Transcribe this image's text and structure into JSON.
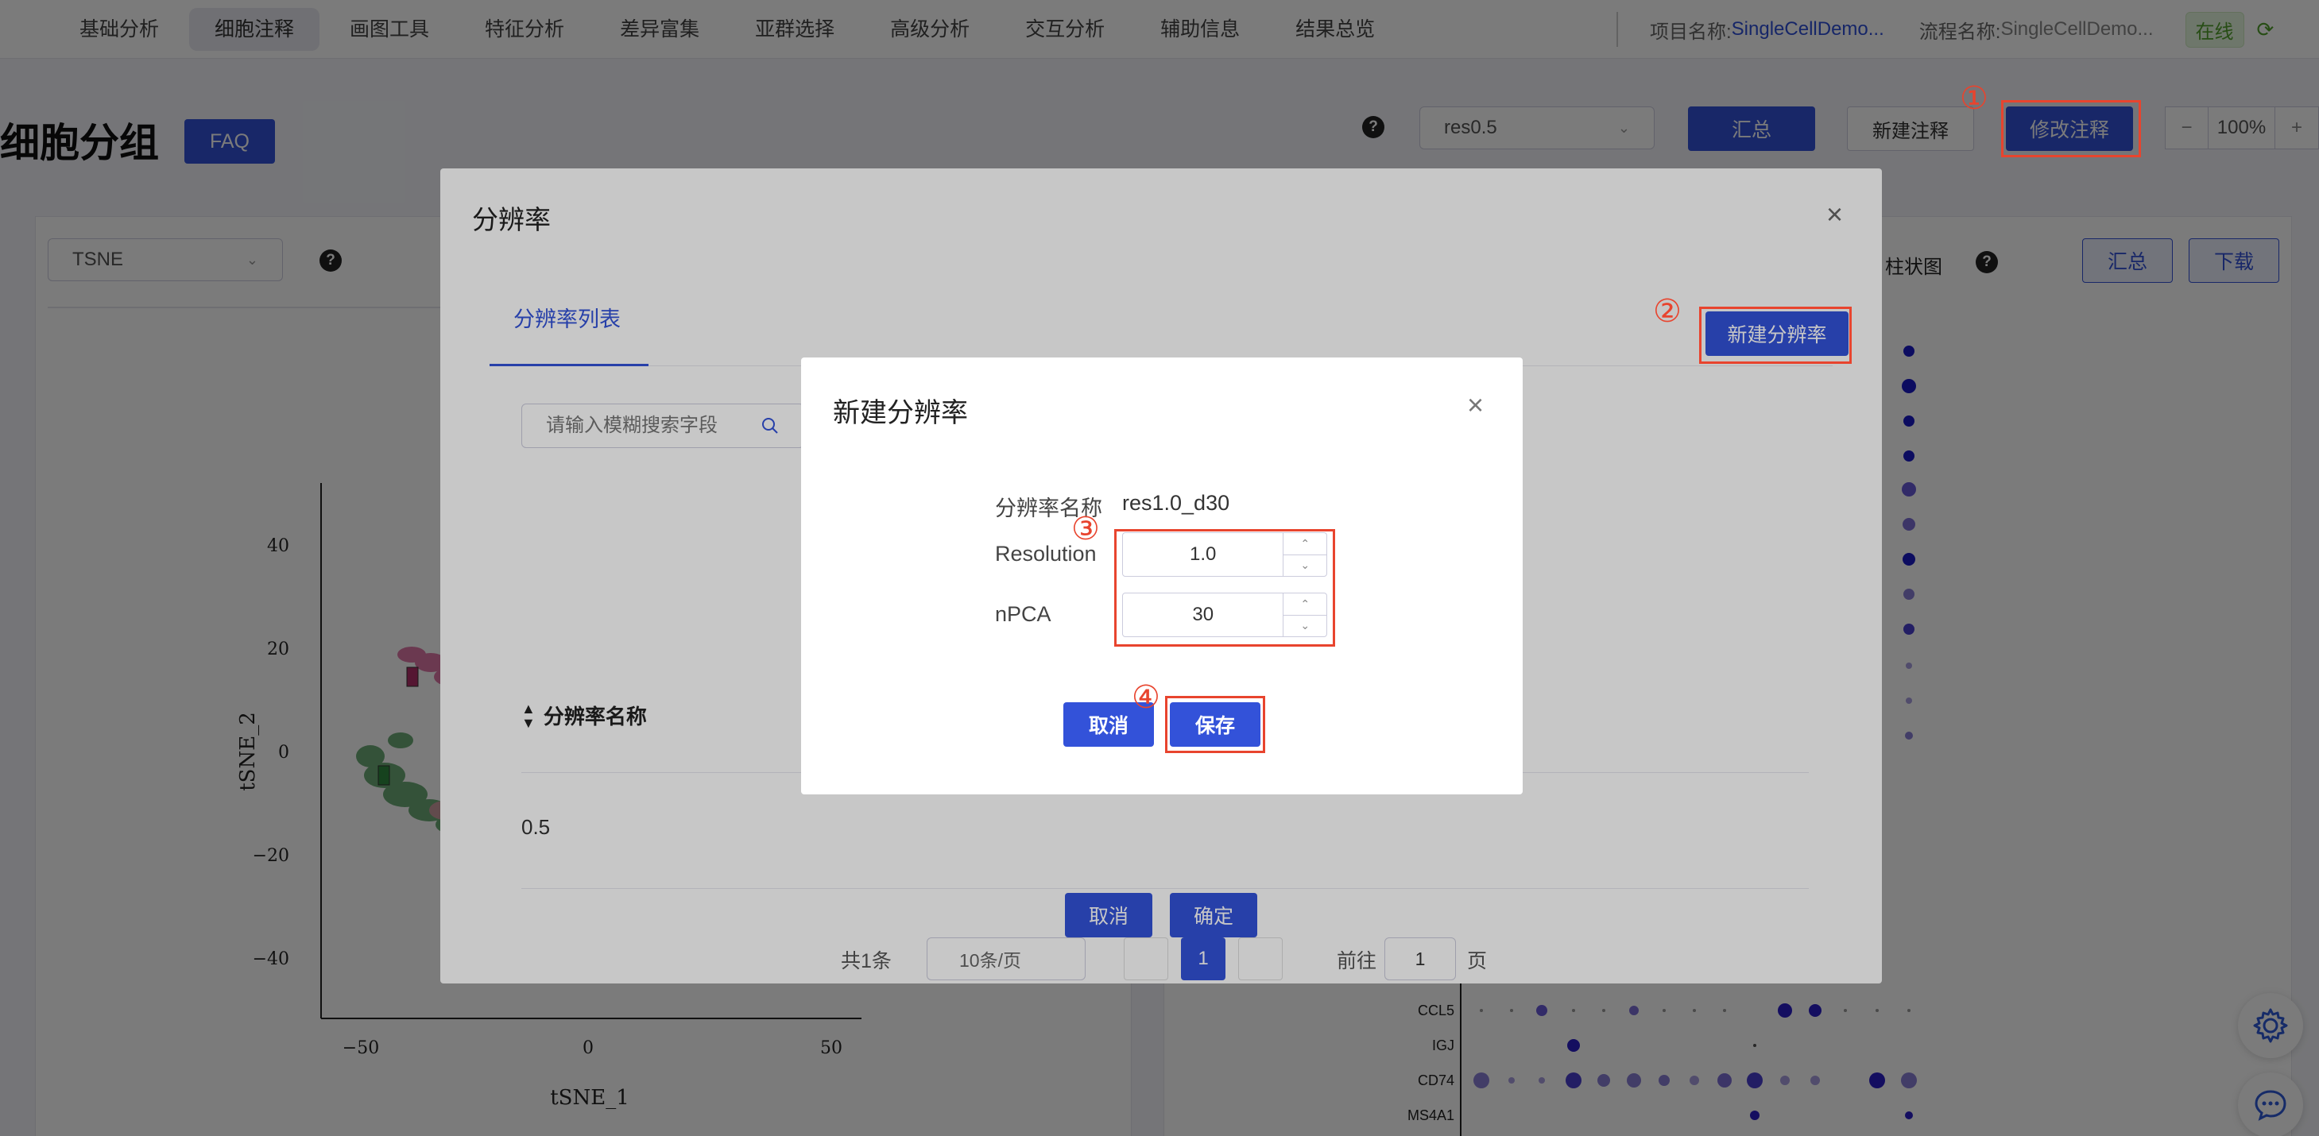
{
  "nav": {
    "tabs": [
      "基础分析",
      "细胞注释",
      "画图工具",
      "特征分析",
      "差异富集",
      "亚群选择",
      "高级分析",
      "交互分析",
      "辅助信息",
      "结果总览"
    ],
    "project_label": "项目名称:",
    "project_value": "SingleCellDemo...",
    "flow_label": "流程名称:",
    "flow_value": "SingleCellDemo...",
    "status": "在线"
  },
  "header": {
    "title": "细胞分组",
    "faq": "FAQ",
    "resolution_select": "res0.5",
    "summary": "汇总",
    "new_annotation": "新建注释",
    "edit_annotation": "修改注释",
    "zoom_minus": "−",
    "zoom": "100%",
    "zoom_plus": "+"
  },
  "left_panel": {
    "reduction_select": "TSNE",
    "xlabel": "tSNE_1",
    "ylabel": "tSNE_2",
    "xticks": [
      "−50",
      "0",
      "50"
    ],
    "yticks": [
      "40",
      "20",
      "0",
      "−20",
      "−40"
    ]
  },
  "right_panel": {
    "barchart_label": "柱状图",
    "summary": "汇总",
    "download": "下载",
    "genes": [
      "CCL5",
      "IGJ",
      "CD74",
      "MS4A1"
    ]
  },
  "resolution_dialog": {
    "title": "分辨率",
    "tab": "分辨率列表",
    "new_resolution": "新建分辨率",
    "search_placeholder": "请输入模糊搜索字段",
    "column_name": "分辨率名称",
    "rows": [
      "0.5"
    ],
    "pager_total": "共1条",
    "pager_size": "10条/页",
    "pager_current": "1",
    "pager_goto": "前往",
    "pager_goto_value": "1",
    "pager_page_unit": "页",
    "cancel": "取消",
    "ok": "确定"
  },
  "new_resolution_dialog": {
    "title": "新建分辨率",
    "name_label": "分辨率名称",
    "name_value": "res1.0_d30",
    "resolution_label": "Resolution",
    "resolution_value": "1.0",
    "npca_label": "nPCA",
    "npca_value": "30",
    "cancel": "取消",
    "save": "保存"
  },
  "annotations": [
    "①",
    "②",
    "③",
    "④"
  ],
  "colors": {
    "primary": "#3352d9",
    "annotation_red": "#e8442e",
    "online_green": "#52a12c"
  }
}
